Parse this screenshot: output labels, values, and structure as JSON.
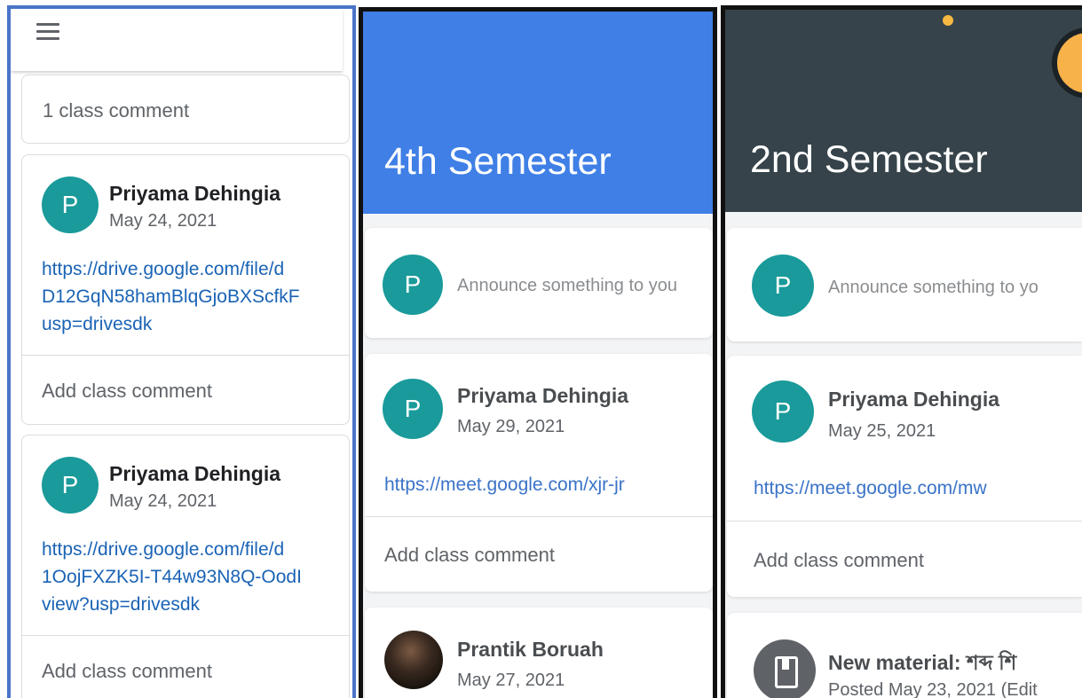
{
  "panel1": {
    "class_comment_count": "1 class comment",
    "posts": [
      {
        "avatar_letter": "P",
        "author": "Priyama Dehingia",
        "date": "May 24, 2021",
        "link_lines": [
          "https://drive.google.com/file/d",
          "D12GqN58hamBlqGjoBXScfkF",
          "usp=drivesdk"
        ],
        "add_comment": "Add class comment"
      },
      {
        "avatar_letter": "P",
        "author": "Priyama Dehingia",
        "date": "May 24, 2021",
        "link_lines": [
          "https://drive.google.com/file/d",
          "1OojFXZK5I-T44w93N8Q-OodI",
          "view?usp=drivesdk"
        ],
        "add_comment": "Add class comment"
      }
    ]
  },
  "panel2": {
    "class_title": "4th Semester",
    "banner_color": "#3f7fe6",
    "announce_avatar": "P",
    "announce_placeholder": "Announce something to you",
    "post": {
      "avatar_letter": "P",
      "author": "Priyama Dehingia",
      "date": "May 29, 2021",
      "link": "https://meet.google.com/xjr-jr",
      "add_comment": "Add class comment"
    },
    "next_post": {
      "author": "Prantik Boruah",
      "date": "May 27, 2021"
    }
  },
  "panel3": {
    "class_title": "2nd Semester",
    "banner_color": "#36434a",
    "announce_avatar": "P",
    "announce_placeholder": "Announce something to yo",
    "post": {
      "avatar_letter": "P",
      "author": "Priyama Dehingia",
      "date": "May 25, 2021",
      "link": "https://meet.google.com/mw",
      "add_comment": "Add class comment"
    },
    "material": {
      "icon": "class-material-icon",
      "title": "New material: শব্দ শি",
      "posted": "Posted May 23, 2021 (Edit"
    }
  }
}
